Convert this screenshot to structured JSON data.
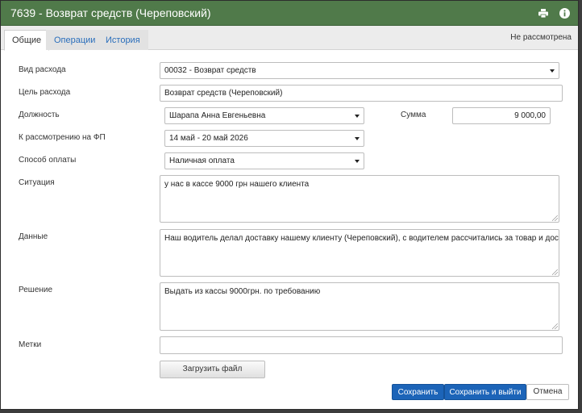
{
  "window": {
    "title": "7639 - Возврат средств (Череповский)"
  },
  "tabs": [
    {
      "label": "Общие",
      "active": true
    },
    {
      "label": "Операции",
      "active": false
    },
    {
      "label": "История",
      "active": false
    }
  ],
  "status": "Не рассмотрена",
  "form": {
    "expense_type": {
      "label": "Вид расхода",
      "value": "00032 - Возврат средств"
    },
    "expense_purpose": {
      "label": "Цель расхода",
      "value": "Возврат средств (Череповский)"
    },
    "position": {
      "label": "Должность",
      "value": "Шарапа Анна Евгеньевна"
    },
    "amount": {
      "label": "Сумма",
      "value": "9 000,00"
    },
    "review_period": {
      "label": "К рассмотрению на ФП",
      "value": "14 май - 20 май 2026"
    },
    "payment_method": {
      "label": "Способ оплаты",
      "value": "Наличная оплата"
    },
    "situation": {
      "label": "Ситуация",
      "value": "у нас в кассе 9000 грн нашего клиента"
    },
    "details": {
      "label": "Данные",
      "value": "Наш водитель делал доставку нашему клиенту (Череповский), с водителем рассчитались за товар и доставку."
    },
    "decision": {
      "label": "Решение",
      "value": "Выдать из кассы 9000грн. по требованию"
    },
    "tags": {
      "label": "Метки",
      "value": ""
    }
  },
  "buttons": {
    "upload": "Загрузить файл",
    "save": "Сохранить",
    "save_exit": "Сохранить и выйти",
    "cancel": "Отмена"
  },
  "icons": {
    "print": "printer-icon",
    "info": "info-icon"
  }
}
